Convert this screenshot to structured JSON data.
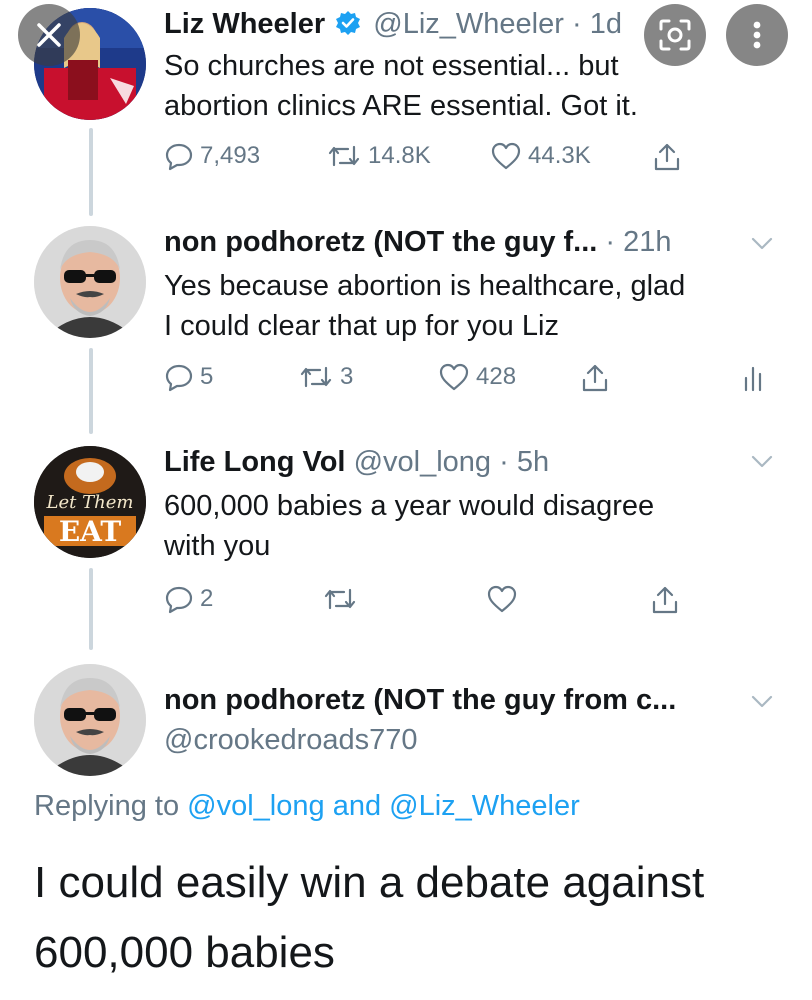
{
  "overlay": {
    "close_icon": "close-icon",
    "lens_icon": "lens-search-icon",
    "more_icon": "more-vertical-icon"
  },
  "tweets": [
    {
      "name": "Liz Wheeler",
      "verified": true,
      "handle": "@Liz_Wheeler",
      "time": "1d",
      "text_lines": [
        "So churches are not essential... but",
        "abortion clinics ARE essential. Got it."
      ],
      "replies": "7,493",
      "retweets": "14.8K",
      "likes": "44.3K"
    },
    {
      "name": "non podhoretz (NOT the guy f...",
      "time": "21h",
      "text_lines": [
        "Yes because abortion is healthcare, glad",
        "I could clear that up for you Liz"
      ],
      "replies": "5",
      "retweets": "3",
      "likes": "428"
    },
    {
      "name": "Life Long Vol",
      "handle": "@vol_long",
      "time": "5h",
      "text_lines": [
        "600,000 babies a year would disagree",
        "with you"
      ],
      "replies": "2",
      "avatar_text": "Let Them EAT"
    }
  ],
  "focused": {
    "name": "non podhoretz (NOT the guy from c...",
    "handle": "@crookedroads770",
    "replying_prefix": "Replying to",
    "mention1": "@vol_long",
    "and": "and",
    "mention2": "@Liz_Wheeler",
    "text_lines": [
      "I could easily win a debate against",
      "600,000 babies"
    ]
  },
  "colors": {
    "text": "#14171a",
    "muted": "#657786",
    "link": "#1da1f2",
    "thread_line": "#ccd6dd"
  }
}
